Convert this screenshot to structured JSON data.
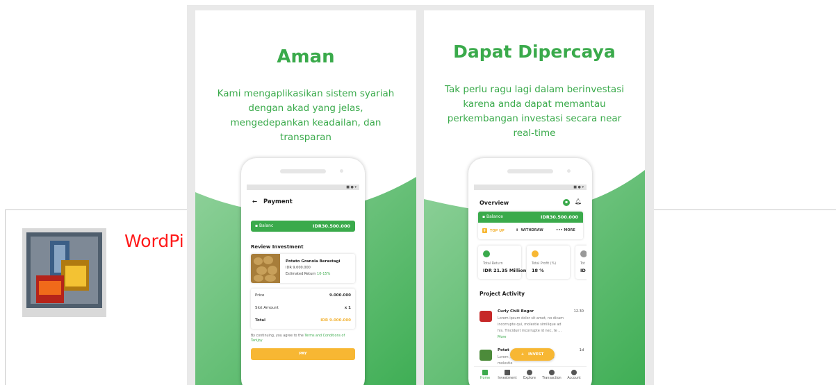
{
  "listing": {
    "app_title": "WordPi"
  },
  "panels": [
    {
      "title": "Aman",
      "description": "Kami mengaplikasikan sistem syariah dengan akad yang jelas, mengedepankan keadailan, dan transparan",
      "screen": {
        "header": "Payment",
        "balance_label": "Balanc",
        "balance_value": "IDR30.500.000",
        "section_title": "Review Investment",
        "product": {
          "name": "Potato Granola Berastagi",
          "price": "IDR 9.000.000",
          "return_label": "Estimated Return",
          "return_value": "10-15%"
        },
        "rows": [
          {
            "label": "Price",
            "value": "9.000.000"
          },
          {
            "label": "Slot Amount",
            "value": "x 1"
          },
          {
            "label": "Total",
            "value": "IDR 9.000.000"
          }
        ],
        "terms_text": "By continuing, you agree to the",
        "terms_link": "Terms and Conditions of Tanijoy",
        "pay_label": "PAY"
      }
    },
    {
      "title": "Dapat Dipercaya",
      "description": "Tak perlu ragu lagi dalam berinvestasi karena anda dapat memantau perkembangan investasi secara near real-time",
      "screen": {
        "header": "Overview",
        "balance_label": "Balance",
        "balance_value": "IDR30.500.000",
        "actions": [
          {
            "label": "TOP UP"
          },
          {
            "label": "WITHDRAW"
          },
          {
            "label": "MORE"
          }
        ],
        "stats": [
          {
            "label": "Total Return",
            "value": "IDR 21.35 Million"
          },
          {
            "label": "Total Profit (%)",
            "value": "18 %"
          },
          {
            "label": "Tot",
            "value": "ID"
          }
        ],
        "section_title": "Project Activity",
        "activities": [
          {
            "name": "Curly Chili Bogor",
            "time": "12.30",
            "text": "Lorem ipsum dolor sit amet, no dicam incorrupte qui, molestie similique ad his. Tincidunt incorrupte id nec, te ...",
            "more": "More"
          },
          {
            "name": "Potat",
            "time": "1d",
            "text": "Lorem              , no dicam incorrupte qui, molestie"
          }
        ],
        "invest_label": "INVEST",
        "nav": [
          "Home",
          "Investment",
          "Explore",
          "Transaction",
          "Account"
        ]
      }
    }
  ],
  "colors": {
    "brand_green": "#3aaa4b",
    "accent_yellow": "#f7b733",
    "listing_title": "#ff1a1a"
  }
}
